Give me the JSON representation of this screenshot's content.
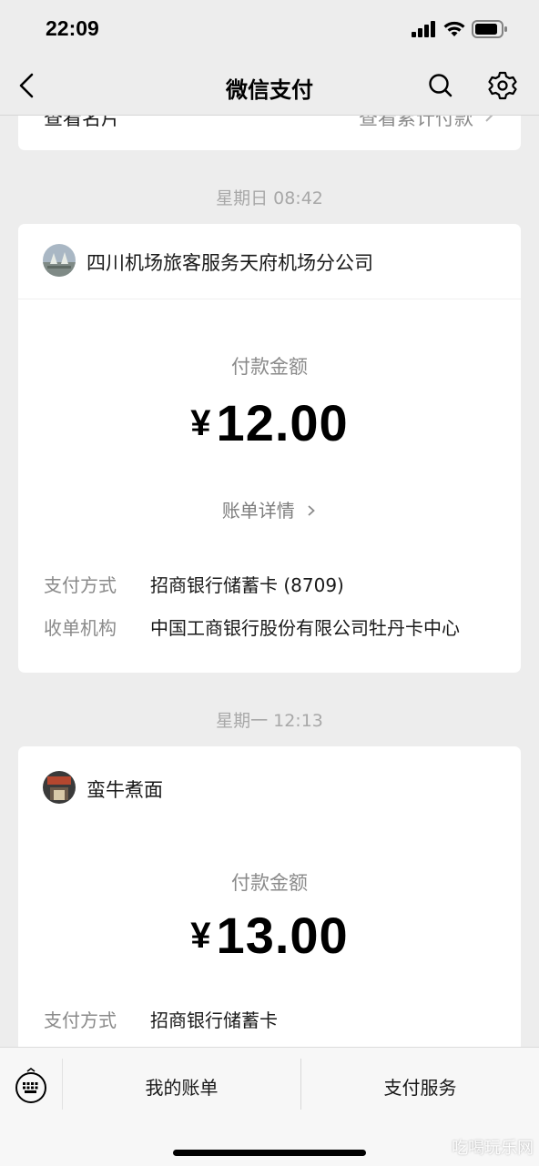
{
  "status": {
    "time": "22:09"
  },
  "nav": {
    "title": "微信支付"
  },
  "top_card": {
    "left": "查看名片",
    "right": "查看累计付款"
  },
  "transactions": [
    {
      "time": "星期日 08:42",
      "merchant": "四川机场旅客服务天府机场分公司",
      "amount_label": "付款金额",
      "currency": "¥",
      "amount": "12.00",
      "detail_link": "账单详情",
      "rows": [
        {
          "label": "支付方式",
          "value": "招商银行储蓄卡 (8709)"
        },
        {
          "label": "收单机构",
          "value": "中国工商银行股份有限公司牡丹卡中心"
        }
      ]
    },
    {
      "time": "星期一 12:13",
      "merchant": "蛮牛煮面",
      "amount_label": "付款金额",
      "currency": "¥",
      "amount": "13.00",
      "rows": [
        {
          "label": "支付方式",
          "value": "招商银行储蓄卡"
        }
      ]
    }
  ],
  "bottom_bar": {
    "bill_label": "我的账单",
    "service_label": "支付服务"
  },
  "watermark": "吃喝玩乐网",
  "colors": {
    "background": "#ededed",
    "card": "#ffffff",
    "secondary_text": "#8a8a8a"
  }
}
